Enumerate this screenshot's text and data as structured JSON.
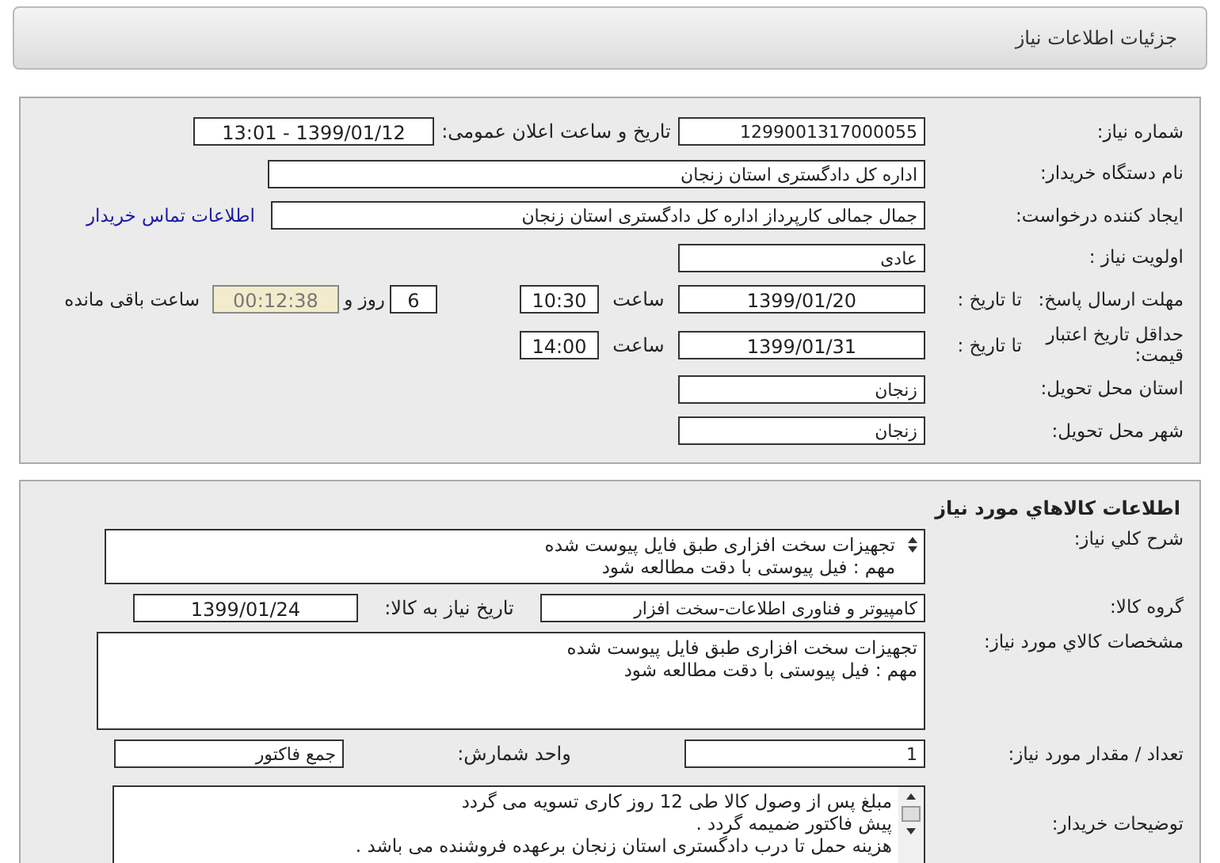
{
  "header": {
    "title": "جزئیات اطلاعات نیاز"
  },
  "details": {
    "need_number": {
      "label": "شماره نیاز:",
      "value": "1299001317000055"
    },
    "announce": {
      "label": "تاریخ و ساعت اعلان عمومی:",
      "value": "1399/01/12 - 13:01"
    },
    "buyer_org": {
      "label": "نام دستگاه خریدار:",
      "value": "اداره کل دادگستری استان زنجان"
    },
    "creator": {
      "label": "ایجاد کننده درخواست:",
      "value": "جمال جمالی کارپرداز اداره کل دادگستری استان زنجان",
      "link": "اطلاعات تماس خریدار"
    },
    "priority": {
      "label": "اولویت نیاز :",
      "value": "عادی"
    },
    "deadline": {
      "label": "مهلت ارسال پاسخ:",
      "to_date_label": "تا تاریخ :",
      "date": "1399/01/20",
      "time_label": "ساعت",
      "time": "10:30",
      "days": "6",
      "days_label": "روز و",
      "remaining": "00:12:38",
      "remaining_label": "ساعت باقی مانده"
    },
    "validity": {
      "label": "حداقل تاریخ اعتبار قیمت:",
      "to_date_label": "تا تاریخ :",
      "date": "1399/01/31",
      "time_label": "ساعت",
      "time": "14:00"
    },
    "province": {
      "label": "استان محل تحویل:",
      "value": "زنجان"
    },
    "city": {
      "label": "شهر محل تحویل:",
      "value": "زنجان"
    }
  },
  "goods": {
    "title": "اطلاعات کالاهاي مورد نياز",
    "description": {
      "label": "شرح کلي نياز:",
      "lines": [
        "تجهیزات سخت افزاری طبق فایل پیوست شده",
        "مهم : فیل پیوستی با دقت مطالعه شود"
      ]
    },
    "group": {
      "label": "گروه کالا:",
      "value": "کامپیوتر و فناوری اطلاعات-سخت افزار",
      "need_date_label": "تاریخ نیاز به کالا:",
      "need_date": "1399/01/24"
    },
    "specs": {
      "label": "مشخصات کالاي مورد نياز:",
      "lines": [
        "تجهیزات سخت افزاری طبق فایل پیوست شده",
        "مهم : فیل پیوستی با دقت مطالعه شود"
      ]
    },
    "quantity": {
      "label": "تعداد / مقدار مورد نیاز:",
      "value": "1",
      "unit_label": "واحد شمارش:",
      "unit": "جمع فاکتور"
    },
    "buyer_notes": {
      "label": "توضیحات خریدار:",
      "lines": [
        "مبلغ پس از وصول کالا طی 12 روز کاری تسویه می گردد",
        "پیش فاکتور ضمیمه گردد .",
        "هزینه حمل تا درب دادگستری استان زنجان برعهده فروشنده می باشد ."
      ]
    }
  }
}
